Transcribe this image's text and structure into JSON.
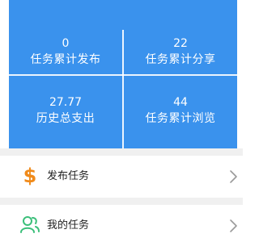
{
  "stats": {
    "published": {
      "value": "0",
      "label": "任务累计发布"
    },
    "shared": {
      "value": "22",
      "label": "任务累计分享"
    },
    "spent": {
      "value": "27.77",
      "label": "历史总支出"
    },
    "views": {
      "value": "44",
      "label": "任务累计浏览"
    }
  },
  "menu": {
    "items": [
      {
        "label": "发布任务",
        "icon": "dollar-icon"
      },
      {
        "label": "我的任务",
        "icon": "users-icon"
      }
    ]
  },
  "colors": {
    "header_blue": "#3a92ed",
    "dollar_orange": "#f08a1a",
    "users_green": "#3bbf7a",
    "chevron_gray": "#9a9a9a",
    "separator_gray": "#f0f0f0"
  }
}
